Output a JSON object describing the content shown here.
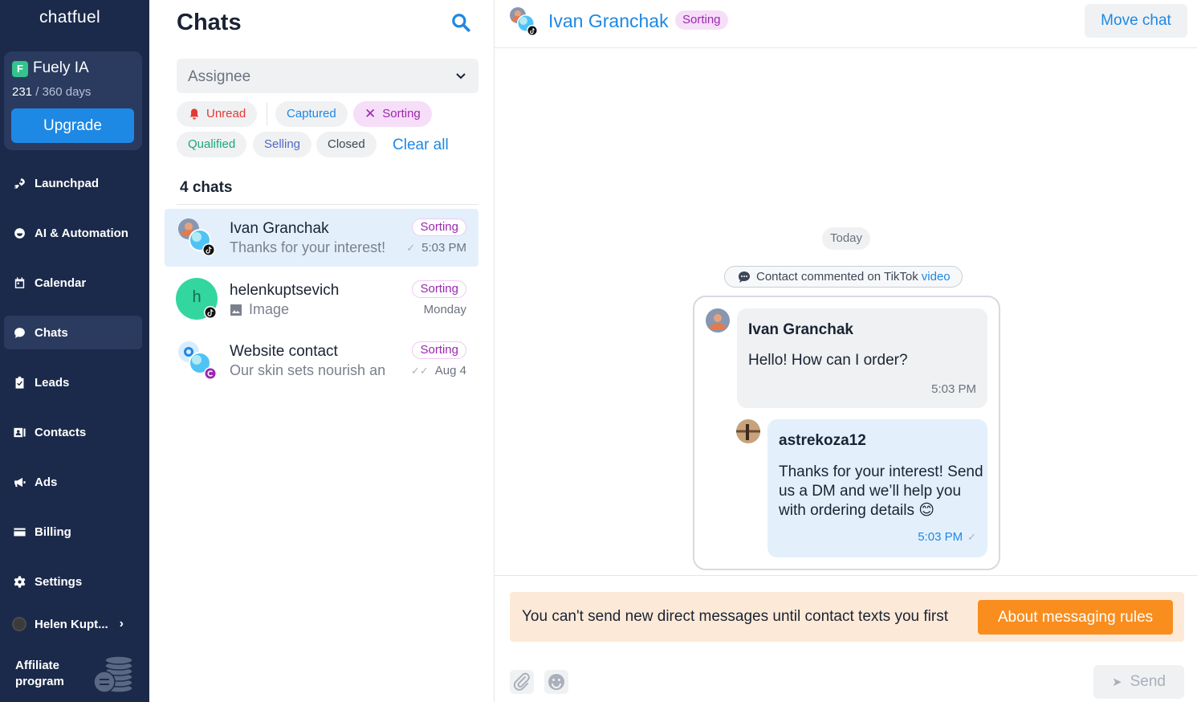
{
  "sidebar": {
    "logo": "chatfuel",
    "plan": {
      "badge": "F",
      "name": "Fuely IA",
      "days_used": "231",
      "days_total": "/ 360 days",
      "upgrade_label": "Upgrade"
    },
    "items": [
      {
        "label": "Launchpad",
        "icon": "rocket-icon"
      },
      {
        "label": "AI & Automation",
        "icon": "ai-icon"
      },
      {
        "label": "Calendar",
        "icon": "calendar-icon"
      },
      {
        "label": "Chats",
        "icon": "chat-bubble-icon",
        "active": true
      },
      {
        "label": "Leads",
        "icon": "clipboard-icon"
      },
      {
        "label": "Contacts",
        "icon": "contacts-icon"
      },
      {
        "label": "Ads",
        "icon": "megaphone-icon"
      },
      {
        "label": "Billing",
        "icon": "credit-card-icon"
      },
      {
        "label": "Settings",
        "icon": "gear-icon"
      }
    ],
    "user_name": "Helen Kupt...",
    "affiliate_line1": "Affiliate",
    "affiliate_line2": "program"
  },
  "chat_list": {
    "title": "Chats",
    "assignee_placeholder": "Assignee",
    "filters": {
      "unread": "Unread",
      "captured": "Captured",
      "sorting": "Sorting",
      "qualified": "Qualified",
      "selling": "Selling",
      "closed": "Closed",
      "clear_all": "Clear all"
    },
    "count_label": "4 chats",
    "chats": [
      {
        "name": "Ivan Granchak",
        "preview": "Thanks for your interest!",
        "status": "Sorting",
        "time": "5:03 PM",
        "active": true
      },
      {
        "name": "helenkuptsevich",
        "avatar_letter": "h",
        "preview": "Image",
        "status": "Sorting",
        "time": "Monday"
      },
      {
        "name": "Website contact",
        "preview": "Our skin sets nourish and",
        "status": "Sorting",
        "time": "Aug 4"
      }
    ]
  },
  "conversation": {
    "contact_name": "Ivan Granchak",
    "status": "Sorting",
    "move_label": "Move chat",
    "date_divider": "Today",
    "note_text": "Contact commented on TikTok",
    "note_link": "video",
    "messages": [
      {
        "author": "Ivan Granchak",
        "text": "Hello! How can I order?",
        "time": "5:03 PM"
      },
      {
        "author": "astrekoza12",
        "text": "Thanks for your interest! Send us a DM and we’ll help you with ordering details 😊",
        "time": "5:03 PM"
      }
    ],
    "rules_text": "You can't send new direct messages until contact texts you first",
    "rules_button": "About messaging rules",
    "send_label": "Send"
  },
  "colors": {
    "sidebar_bg": "#1b2a4a",
    "accent": "#1e88e5",
    "sorting": "#9c27b0",
    "warning_bg": "#fde9d7",
    "warning_btn": "#f98d1e"
  }
}
